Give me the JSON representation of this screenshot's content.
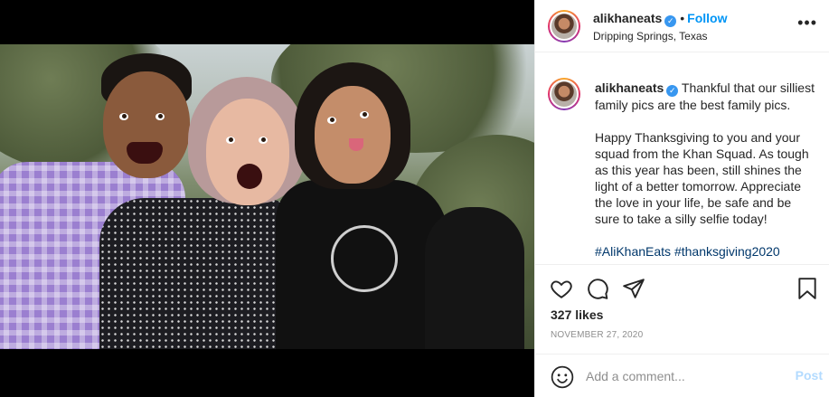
{
  "post": {
    "username": "alikhaneats",
    "verified_icon": "verified-badge-icon",
    "follow_label": "Follow",
    "separator": "•",
    "location": "Dripping Springs, Texas",
    "more_label": "•••"
  },
  "caption": {
    "username": "alikhaneats",
    "intro": "Thankful that our silliest family pics are the best family pics.",
    "body": "Happy Thanksgiving to you and your squad from the Khan Squad. As tough as this year has been, still shines the light of a better tomorrow. Appreciate the love in your life, be safe and be sure to take a silly selfie today!",
    "hashtags": [
      "#AliKhanEats",
      "#thanksgiving2020"
    ]
  },
  "actions": {
    "icons": [
      "heart-icon",
      "comment-icon",
      "share-icon",
      "bookmark-icon"
    ]
  },
  "likes": "327 likes",
  "date": "NOVEMBER 27, 2020",
  "comment": {
    "placeholder": "Add a comment...",
    "post_label": "Post"
  },
  "colors": {
    "link_blue": "#0095f6",
    "verified_blue": "#3897f0",
    "hashtag": "#00376b",
    "muted": "#8e8e8e",
    "post_disabled": "#b3dbff"
  }
}
